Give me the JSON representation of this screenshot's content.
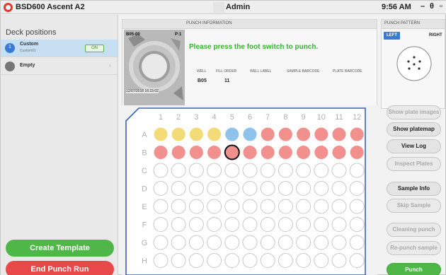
{
  "titlebar": {
    "app_name": "BSD600 Ascent A2",
    "user": "Admin",
    "time": "9:56 AM",
    "minimize": "–",
    "maximize": "θ",
    "close": "▫"
  },
  "sidebar": {
    "title": "Deck positions",
    "decks": [
      {
        "number": "1",
        "name": "Custom",
        "sub": "Custom01",
        "status": "ON"
      },
      {
        "name": "Empty"
      }
    ],
    "create_label": "Create Template",
    "end_label": "End Punch Run"
  },
  "punch_info": {
    "title": "PUNCH INFORMATION",
    "camera_well": "B05-00",
    "camera_pos": "P:1",
    "camera_stamp": "12/07/2018 16:15:02",
    "message": "Please press the foot switch to punch.",
    "headers": [
      "WELL",
      "FILL ORDER",
      "WELL LABEL",
      "SAMPLE BARCODE",
      "PLATE BARCODE"
    ],
    "well": "B05",
    "fill_order": "11"
  },
  "pattern": {
    "title": "PUNCH PATTERN",
    "left_label": "LEFT",
    "right_label": "RIGHT"
  },
  "plate": {
    "columns": [
      "1",
      "2",
      "3",
      "4",
      "5",
      "6",
      "7",
      "8",
      "9",
      "10",
      "11",
      "12"
    ],
    "rows": [
      "A",
      "B",
      "C",
      "D",
      "E",
      "F",
      "G",
      "H"
    ],
    "states": [
      [
        "Y",
        "Y",
        "Y",
        "Y",
        "B",
        "B",
        "R",
        "R",
        "R",
        "R",
        "R",
        "R"
      ],
      [
        "R",
        "R",
        "R",
        "R",
        "S",
        "R",
        "R",
        "R",
        "R",
        "R",
        "R",
        "R"
      ],
      [
        "E",
        "E",
        "E",
        "E",
        "E",
        "E",
        "E",
        "E",
        "E",
        "E",
        "E",
        "E"
      ],
      [
        "E",
        "E",
        "E",
        "E",
        "E",
        "E",
        "E",
        "E",
        "E",
        "E",
        "E",
        "E"
      ],
      [
        "E",
        "E",
        "E",
        "E",
        "E",
        "E",
        "E",
        "E",
        "E",
        "E",
        "E",
        "E"
      ],
      [
        "E",
        "E",
        "E",
        "E",
        "E",
        "E",
        "E",
        "E",
        "E",
        "E",
        "E",
        "E"
      ],
      [
        "E",
        "E",
        "E",
        "E",
        "E",
        "E",
        "E",
        "E",
        "E",
        "E",
        "E",
        "E"
      ],
      [
        "E",
        "E",
        "E",
        "E",
        "E",
        "E",
        "E",
        "E",
        "E",
        "E",
        "E",
        "E"
      ]
    ],
    "colors": {
      "Y": "#f3dc78",
      "B": "#8fc3ec",
      "R": "#f2908e",
      "S": "#f2908e",
      "E": "#ffffff"
    }
  },
  "actions": {
    "show_plate_images": "Show plate images",
    "show_platemap": "Show platemap",
    "view_log": "View Log",
    "inspect_plates": "Inspect Plates",
    "sample_info": "Sample Info",
    "skip_sample": "Skip Sample",
    "cleaning_punch": "Cleaning punch",
    "repunch_sample": "Re-punch sample",
    "punch": "Punch"
  }
}
